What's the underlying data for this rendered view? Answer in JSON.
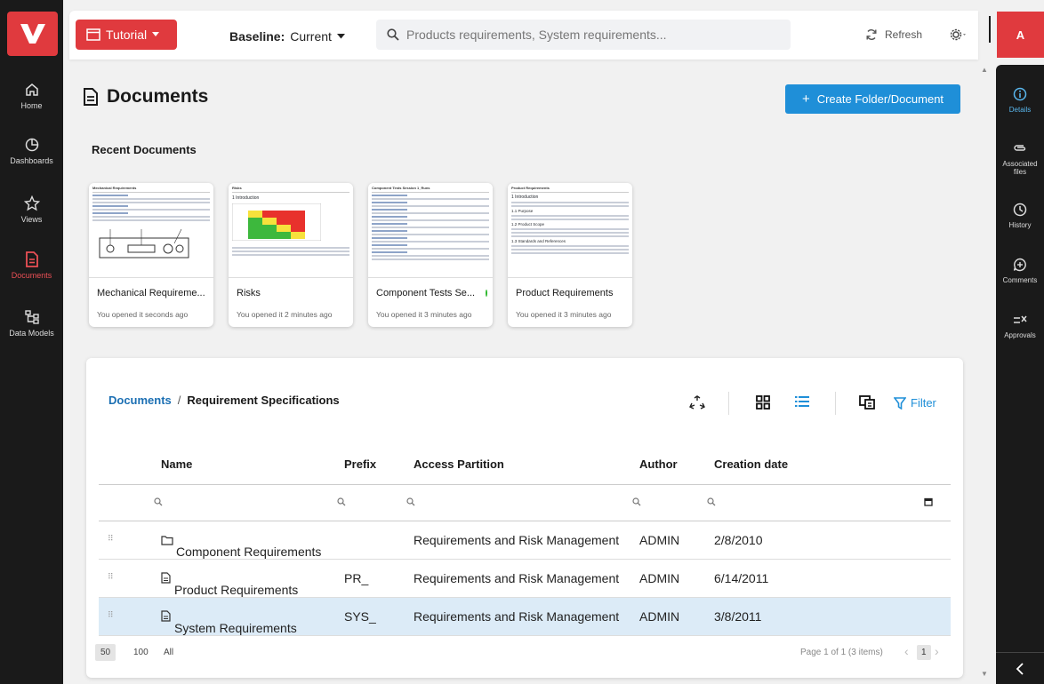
{
  "colors": {
    "brand": "#e03a3e",
    "accent": "#1f8fd8",
    "nav_bg": "#1a1a1a",
    "link": "#1b6fb3",
    "status_green": "#2eb82e"
  },
  "topbar": {
    "tutorial_label": "Tutorial",
    "baseline_label": "Baseline:",
    "baseline_value": "Current",
    "search_placeholder": "Products requirements, System requirements...",
    "refresh_label": "Refresh",
    "avatar_initial": "A"
  },
  "leftnav": {
    "items": [
      {
        "label": "Home",
        "icon": "home-icon"
      },
      {
        "label": "Dashboards",
        "icon": "pie-chart-icon"
      },
      {
        "label": "Views",
        "icon": "star-icon"
      },
      {
        "label": "Documents",
        "icon": "document-icon",
        "active": true
      },
      {
        "label": "Data Models",
        "icon": "data-model-icon"
      }
    ]
  },
  "rightpanel": {
    "items": [
      {
        "label": "Details",
        "icon": "info-icon",
        "active": true
      },
      {
        "label": "Associated files",
        "icon": "paperclip-icon"
      },
      {
        "label": "History",
        "icon": "clock-icon"
      },
      {
        "label": "Comments",
        "icon": "comment-add-icon"
      },
      {
        "label": "Approvals",
        "icon": "approvals-icon"
      }
    ]
  },
  "main": {
    "title": "Documents",
    "create_label": "Create Folder/Document",
    "recent_title": "Recent Documents",
    "recent": [
      {
        "title": "Mechanical Requireme...",
        "opened": "You opened it seconds ago",
        "thumb_title": "Mechanical Requirements"
      },
      {
        "title": "Risks",
        "opened": "You opened it 2 minutes ago",
        "thumb_title": "Risks"
      },
      {
        "title": "Component Tests Se...",
        "opened": "You opened it 3 minutes ago",
        "thumb_title": "Component Tests Session 1_Runs"
      },
      {
        "title": "Product Requirements",
        "opened": "You opened it 3 minutes ago",
        "thumb_title": "Product Requirements"
      }
    ]
  },
  "table": {
    "breadcrumb_root": "Documents",
    "breadcrumb_sep": "/",
    "breadcrumb_current": "Requirement Specifications",
    "filter_label": "Filter",
    "columns": [
      "Name",
      "Prefix",
      "Access Partition",
      "Author",
      "Creation date"
    ],
    "rows": [
      {
        "name": "Component Requirements",
        "type": "folder",
        "prefix": "",
        "partition": "Requirements and Risk Management",
        "author": "ADMIN",
        "date": "2/8/2010"
      },
      {
        "name": "Product Requirements",
        "type": "document",
        "prefix": "PR_",
        "partition": "Requirements and Risk Management",
        "author": "ADMIN",
        "date": "6/14/2011"
      },
      {
        "name": "System Requirements",
        "type": "document",
        "prefix": "SYS_",
        "partition": "Requirements and Risk Management",
        "author": "ADMIN",
        "date": "3/8/2011",
        "selected": true
      }
    ],
    "page_sizes": [
      "50",
      "100",
      "All"
    ],
    "page_info": "Page 1 of 1 (3 items)",
    "current_page": "1"
  }
}
